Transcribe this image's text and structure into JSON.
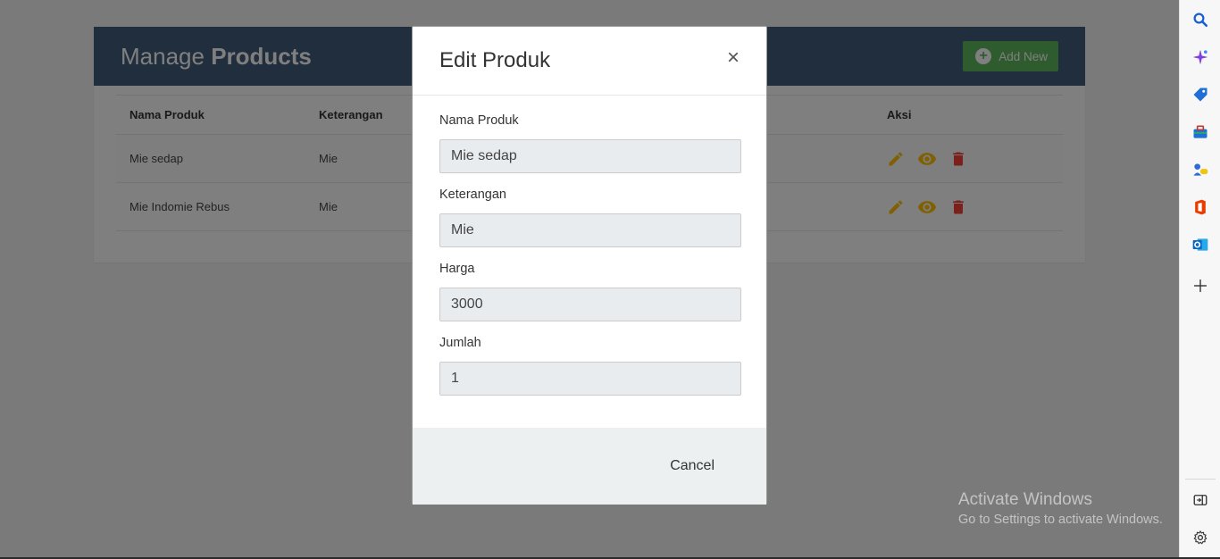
{
  "page": {
    "title_regular": "Manage",
    "title_bold": "Products",
    "add_button_label": "Add New"
  },
  "table": {
    "headers": [
      "Nama Produk",
      "Keterangan",
      "Aksi"
    ],
    "rows": [
      {
        "nama": "Mie sedap",
        "keterangan": "Mie"
      },
      {
        "nama": "Mie Indomie Rebus",
        "keterangan": "Mie"
      }
    ]
  },
  "modal": {
    "title": "Edit Produk",
    "close_label": "×",
    "fields": [
      {
        "label": "Nama Produk",
        "value": "Mie sedap"
      },
      {
        "label": "Keterangan",
        "value": "Mie"
      },
      {
        "label": "Harga",
        "value": "3000"
      },
      {
        "label": "Jumlah",
        "value": "1"
      }
    ],
    "cancel_label": "Cancel"
  },
  "watermark": {
    "line1": "Activate Windows",
    "line2": "Go to Settings to activate Windows."
  },
  "colors": {
    "header_bg": "#435d7d",
    "add_button": "#5cb85c",
    "edit_icon": "#ffc107",
    "view_icon": "#ffc107",
    "delete_icon": "#f44336"
  },
  "edge_sidebar": {
    "icons": [
      "search-icon",
      "copilot-icon",
      "shopping-tag-icon",
      "tools-icon",
      "games-icon",
      "office-icon",
      "outlook-icon",
      "add-icon",
      "sidebar-toggle-icon",
      "settings-icon"
    ]
  }
}
